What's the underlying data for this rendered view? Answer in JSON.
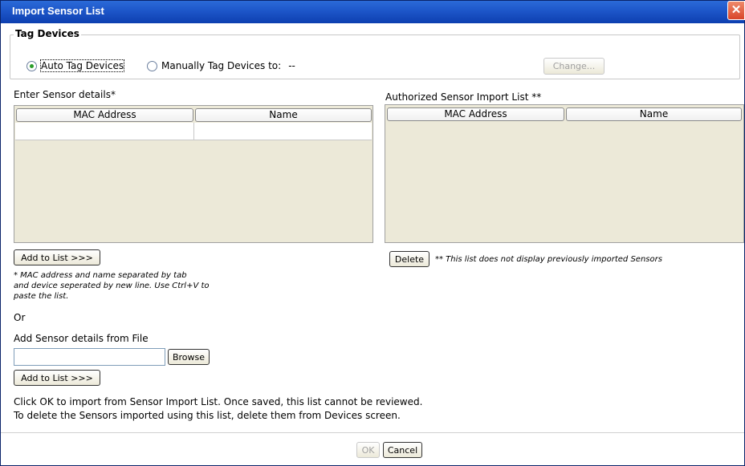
{
  "window": {
    "title": "Import Sensor List",
    "close_glyph": "✕"
  },
  "tag_devices": {
    "legend": "Tag Devices",
    "auto_label": "Auto Tag Devices",
    "manual_label": "Manually Tag Devices to:",
    "manual_value": "--",
    "selected": "auto",
    "change_button": "Change..."
  },
  "enter_section": {
    "label": "Enter Sensor details*",
    "columns": [
      "MAC Address",
      "Name"
    ],
    "row": {
      "mac": "",
      "name": ""
    },
    "add_button": "Add to List >>>",
    "note_line1": "* MAC address and name separated by tab",
    "note_line2": "and device seperated by new line. Use Ctrl+V to",
    "note_line3": "paste the list.",
    "or_text": "Or"
  },
  "file_section": {
    "label": "Add Sensor details from File",
    "file_value": "",
    "browse_button": "Browse",
    "add_button": "Add to List >>>"
  },
  "authorized_section": {
    "label": "Authorized Sensor Import List **",
    "columns": [
      "MAC Address",
      "Name"
    ],
    "delete_button": "Delete",
    "note": "** This list does not display previously imported Sensors"
  },
  "instructions": {
    "line1": "Click OK to import from Sensor Import List. Once saved, this list cannot be reviewed.",
    "line2": "To delete the Sensors imported using this list, delete them from Devices screen."
  },
  "footer": {
    "ok_button": "OK",
    "cancel_button": "Cancel"
  }
}
